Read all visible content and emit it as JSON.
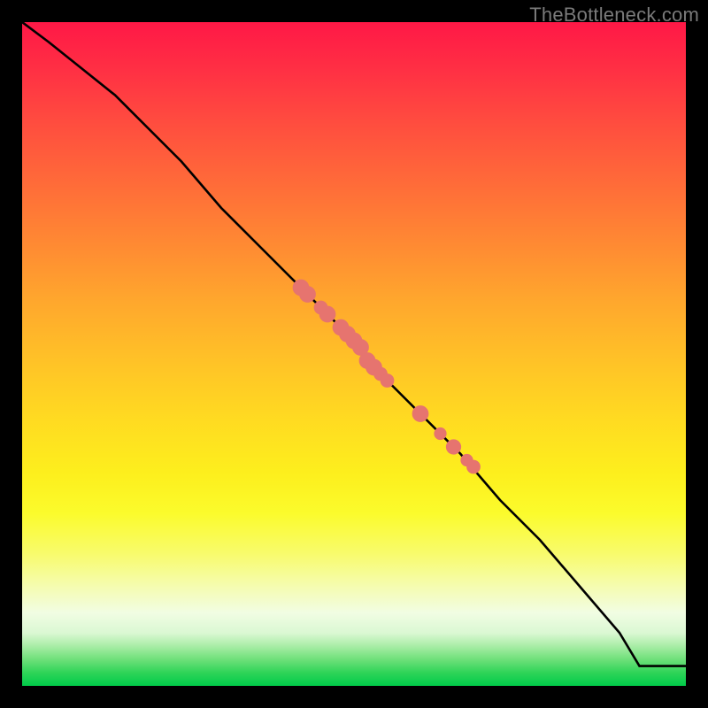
{
  "watermark": "TheBottleneck.com",
  "chart_data": {
    "type": "line",
    "title": "",
    "xlabel": "",
    "ylabel": "",
    "xlim": [
      0,
      100
    ],
    "ylim": [
      0,
      100
    ],
    "grid": false,
    "series": [
      {
        "name": "curve",
        "x": [
          0,
          4,
          9,
          14,
          19,
          24,
          30,
          36,
          42,
          48,
          54,
          60,
          66,
          72,
          78,
          84,
          90,
          93,
          100
        ],
        "y": [
          100,
          97,
          93,
          89,
          84,
          79,
          72,
          66,
          60,
          54,
          47,
          41,
          35,
          28,
          22,
          15,
          8,
          3,
          3
        ]
      }
    ],
    "markers": [
      {
        "x": 42,
        "y": 60,
        "r": 1.2
      },
      {
        "x": 43,
        "y": 59,
        "r": 1.2
      },
      {
        "x": 45,
        "y": 57,
        "r": 1.0
      },
      {
        "x": 46,
        "y": 56,
        "r": 1.2
      },
      {
        "x": 48,
        "y": 54,
        "r": 1.2
      },
      {
        "x": 49,
        "y": 53,
        "r": 1.2
      },
      {
        "x": 50,
        "y": 52,
        "r": 1.2
      },
      {
        "x": 51,
        "y": 51,
        "r": 1.2
      },
      {
        "x": 52,
        "y": 49,
        "r": 1.2
      },
      {
        "x": 53,
        "y": 48,
        "r": 1.2
      },
      {
        "x": 54,
        "y": 47,
        "r": 1.0
      },
      {
        "x": 55,
        "y": 46,
        "r": 1.0
      },
      {
        "x": 60,
        "y": 41,
        "r": 1.2
      },
      {
        "x": 63,
        "y": 38,
        "r": 0.9
      },
      {
        "x": 65,
        "y": 36,
        "r": 1.1
      },
      {
        "x": 67,
        "y": 34,
        "r": 0.9
      },
      {
        "x": 68,
        "y": 33,
        "r": 1.0
      }
    ],
    "colors": {
      "line": "#000000",
      "marker_fill": "#e6746f",
      "marker_stroke": "#e6746f"
    }
  }
}
